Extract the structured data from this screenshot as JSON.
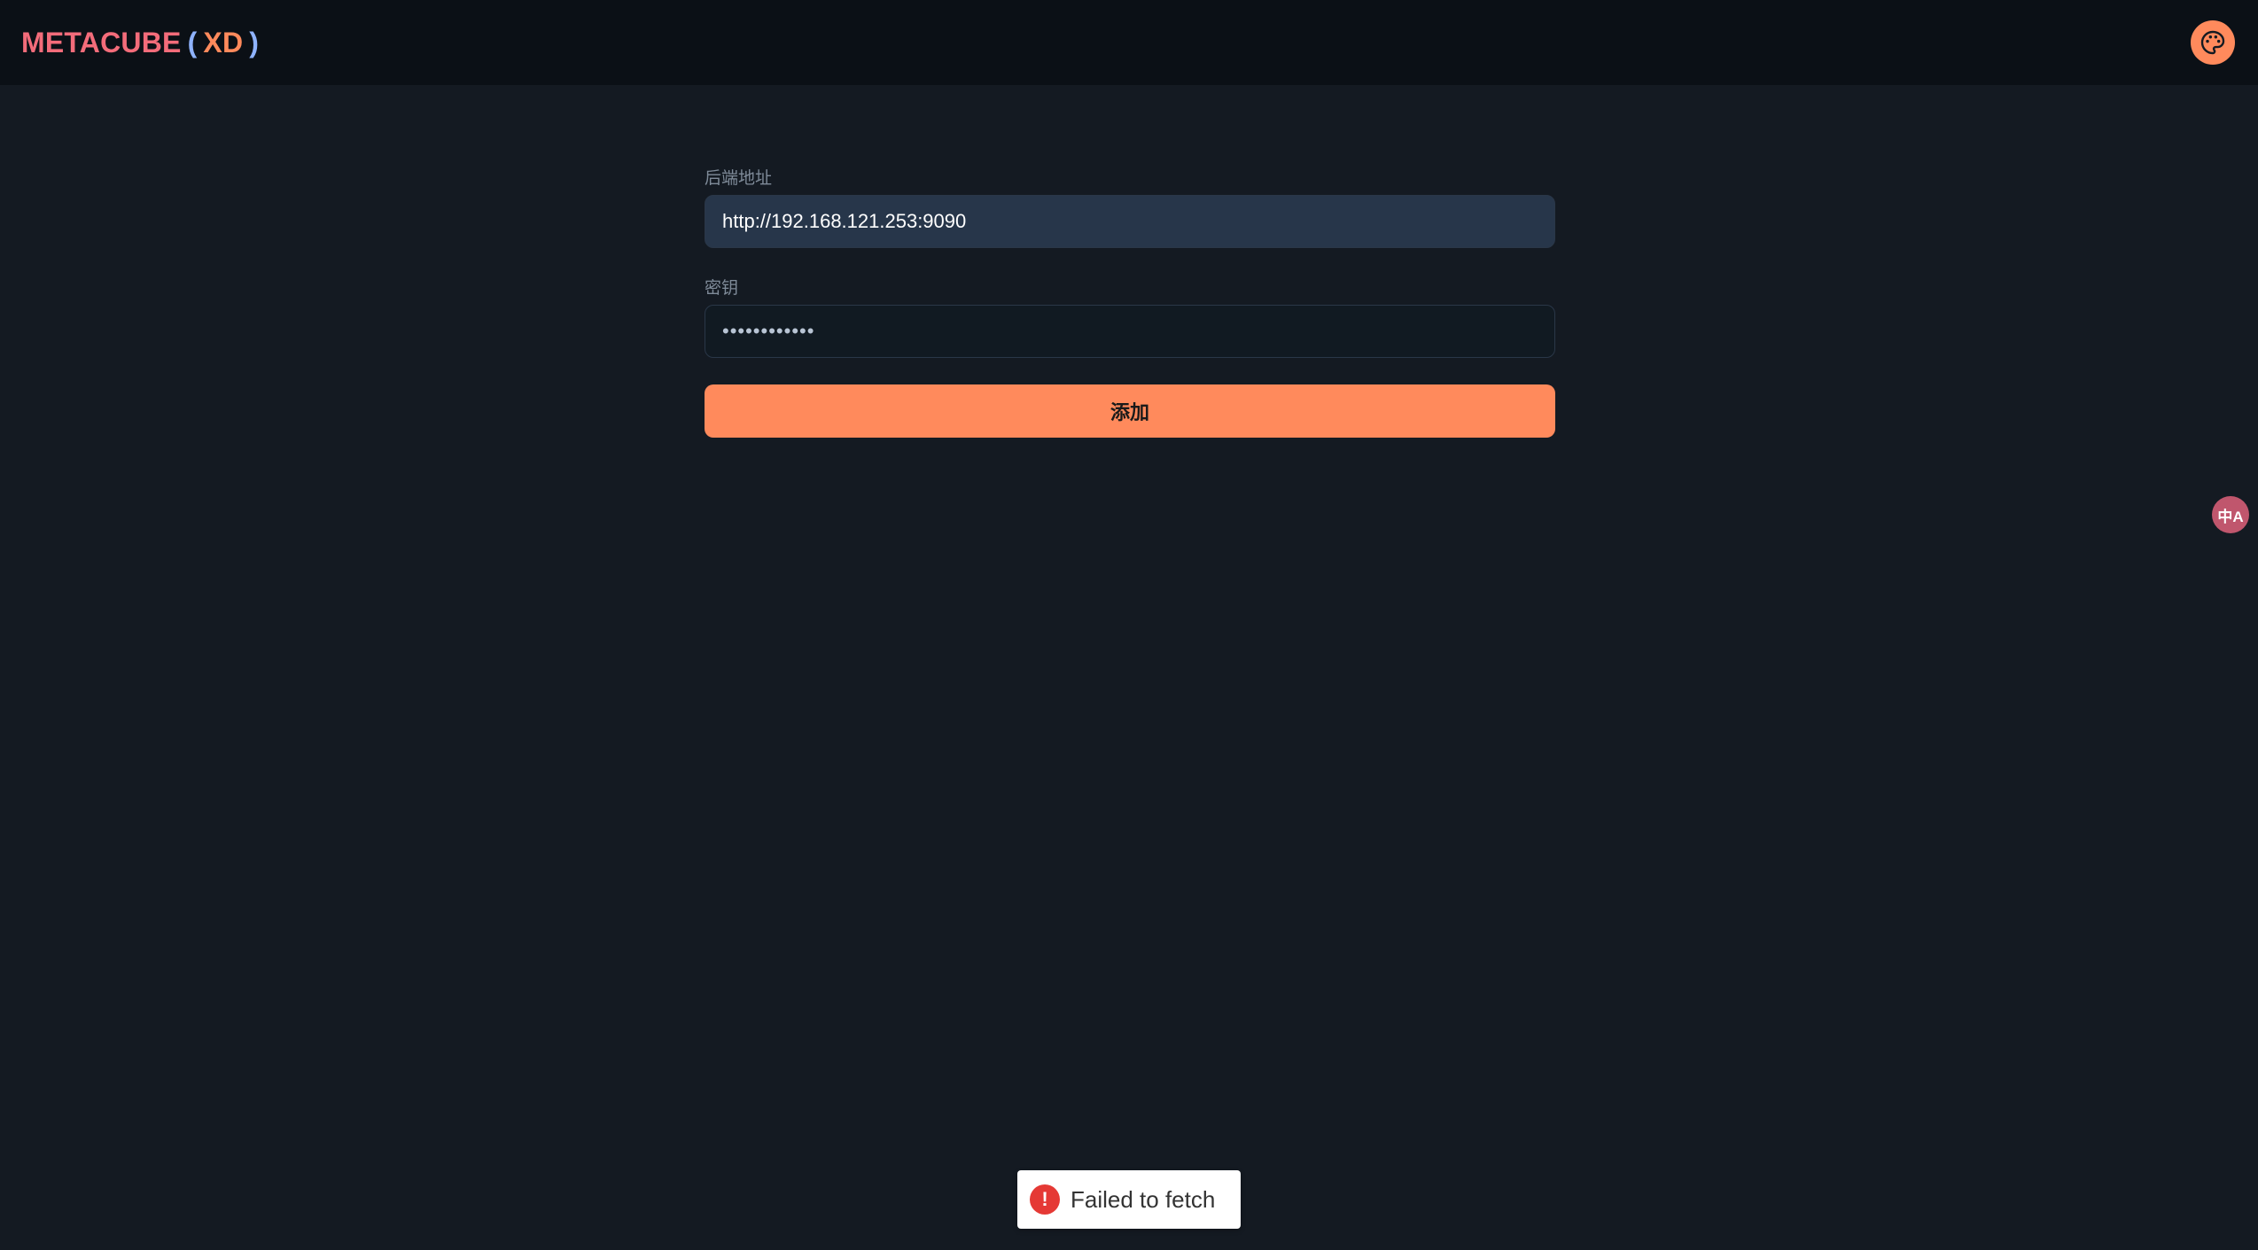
{
  "header": {
    "brand_name": "METACUBE",
    "paren_open": "(",
    "brand_suffix": "XD",
    "paren_close": ")",
    "theme_icon": "palette-icon"
  },
  "form": {
    "backend_label": "后端地址",
    "backend_value": "http://192.168.121.253:9090",
    "secret_label": "密钥",
    "secret_value": "••••••••••••",
    "submit_label": "添加"
  },
  "language_button": {
    "icon": "translate-icon",
    "label": "中A"
  },
  "toast": {
    "icon": "error-icon",
    "message": "Failed to fetch"
  },
  "colors": {
    "background": "#141a22",
    "topbar": "#0b1016",
    "accent": "#ff8a5c",
    "brand": "#f36c7a",
    "paren": "#8fb3ff",
    "language_button": "#c0566d",
    "error": "#e53935"
  }
}
